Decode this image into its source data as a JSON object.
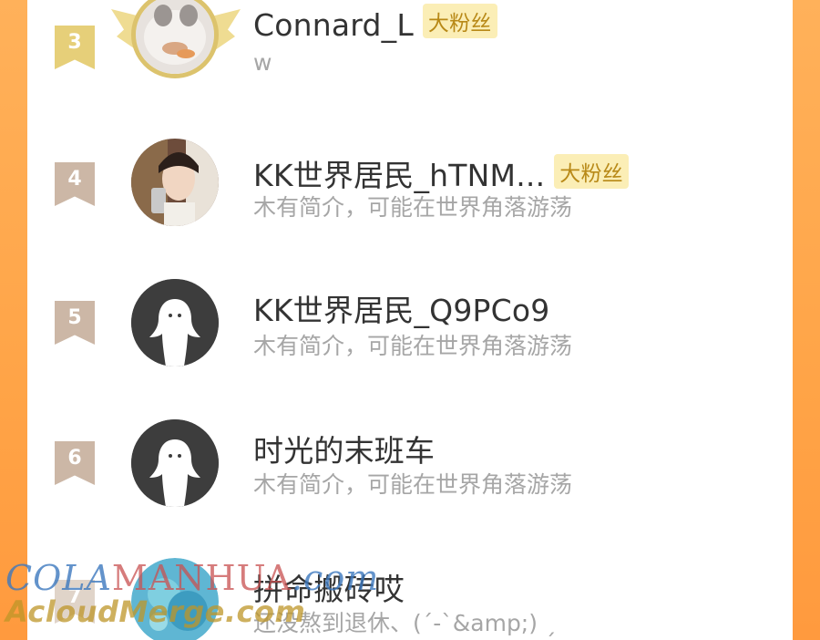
{
  "colors": {
    "frame_orange": "#ffa447",
    "rank_gold": "#e6cf79",
    "rank_plain": "#ccb7a6",
    "badge_bg": "#fbeeb6",
    "badge_text": "#b88917",
    "name_text": "#333333",
    "bio_text": "#a6a6a6"
  },
  "list": [
    {
      "rank": "3",
      "name": "Connard_L",
      "badge": "大粉丝",
      "bio": "w",
      "avatar_icon": "cat-photo-avatar-with-wings"
    },
    {
      "rank": "4",
      "name": "KK世界居民_hTNM...",
      "badge": "大粉丝",
      "bio": "木有简介，可能在世界角落游荡",
      "avatar_icon": "selfie-photo-avatar"
    },
    {
      "rank": "5",
      "name": "KK世界居民_Q9PCo9",
      "badge": "",
      "bio": "木有简介，可能在世界角落游荡",
      "avatar_icon": "default-ghost-avatar"
    },
    {
      "rank": "6",
      "name": "时光的末班车",
      "badge": "",
      "bio": "木有简介，可能在世界角落游荡",
      "avatar_icon": "default-ghost-avatar"
    },
    {
      "rank": "7",
      "name": "拼命搬砖哎",
      "badge": "",
      "bio": "还没熬到退休、(ˊ-ˋ&amp;) ˏ",
      "avatar_icon": "blue-photo-avatar"
    }
  ],
  "watermark": {
    "line1_a": "COLA",
    "line1_b": "MANHUA",
    "line1_c": ".com",
    "line2": "AcloudMerge.com"
  }
}
